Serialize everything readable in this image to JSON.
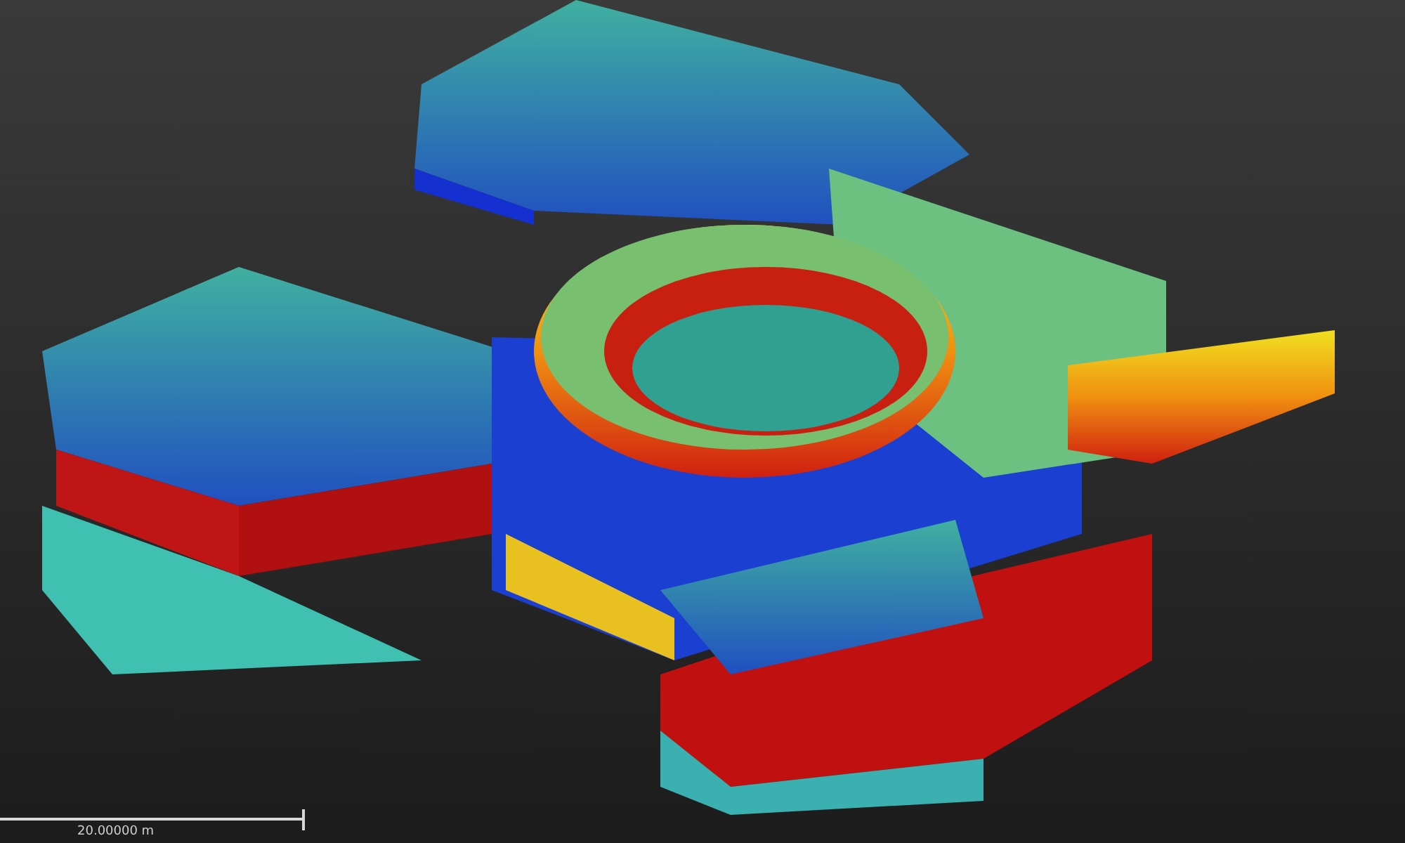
{
  "viewport": {
    "scale_bar": {
      "label": "20.00000 m"
    }
  }
}
